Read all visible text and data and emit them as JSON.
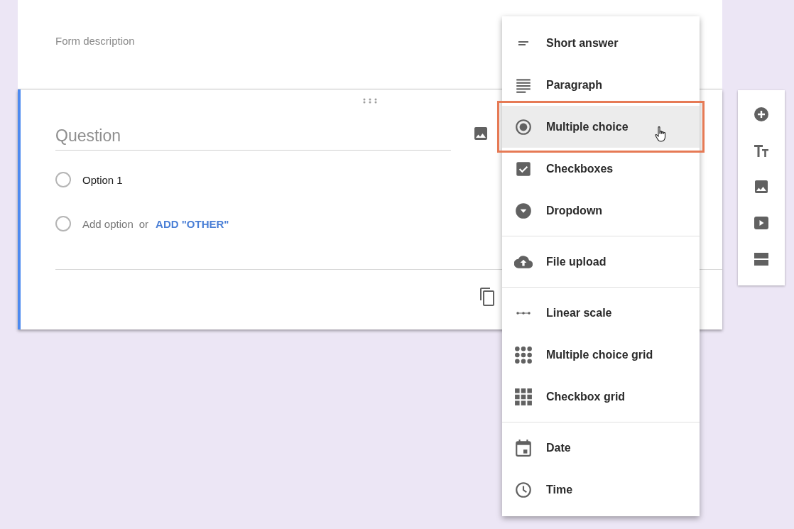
{
  "header": {
    "description_placeholder": "Form description"
  },
  "question": {
    "title_placeholder": "Question",
    "options": [
      {
        "label": "Option 1",
        "selected": false
      }
    ],
    "add_option": {
      "selected": false,
      "label": "Add option",
      "separator": "or",
      "other_link": "ADD \"OTHER\""
    }
  },
  "menu": {
    "groups": [
      {
        "items": [
          {
            "kind": "short",
            "label": "Short answer",
            "selected": false
          },
          {
            "kind": "paragraph",
            "label": "Paragraph",
            "selected": false
          },
          {
            "kind": "radio",
            "label": "Multiple choice",
            "selected": true
          },
          {
            "kind": "checkbox",
            "label": "Checkboxes",
            "selected": false
          },
          {
            "kind": "dropdown",
            "label": "Dropdown",
            "selected": false
          }
        ]
      },
      {
        "items": [
          {
            "kind": "upload",
            "label": "File upload",
            "selected": false
          }
        ]
      },
      {
        "items": [
          {
            "kind": "scale",
            "label": "Linear scale",
            "selected": false
          },
          {
            "kind": "radiogrid",
            "label": "Multiple choice grid",
            "selected": false
          },
          {
            "kind": "checkgrid",
            "label": "Checkbox grid",
            "selected": false
          }
        ]
      },
      {
        "items": [
          {
            "kind": "date",
            "label": "Date",
            "selected": false
          },
          {
            "kind": "time",
            "label": "Time",
            "selected": false
          }
        ]
      }
    ]
  }
}
